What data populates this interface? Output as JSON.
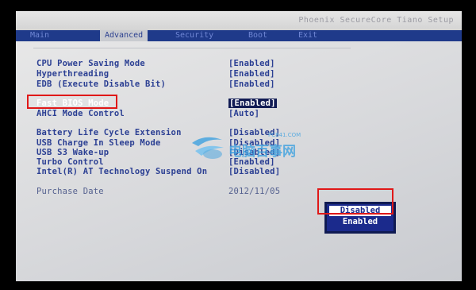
{
  "vendor_text": "Phoenix SecureCore Tiano Setup",
  "tabs": [
    {
      "label": "Main"
    },
    {
      "label": "Advanced"
    },
    {
      "label": "Security"
    },
    {
      "label": "Boot"
    },
    {
      "label": "Exit"
    }
  ],
  "active_tab": "Advanced",
  "settings": [
    {
      "label": "CPU Power Saving Mode",
      "value": "[Enabled]"
    },
    {
      "label": "Hyperthreading",
      "value": "[Enabled]"
    },
    {
      "label": "EDB (Execute Disable Bit)",
      "value": "[Enabled]"
    },
    {
      "label": "Fast BIOS Mode",
      "value": "[Enabled]"
    },
    {
      "label": "AHCI Mode Control",
      "value": "[Auto]"
    },
    {
      "label": "Battery Life Cycle Extension",
      "value": "[Disabled]"
    },
    {
      "label": "USB Charge In Sleep Mode",
      "value": "[Disabled]"
    },
    {
      "label": "USB S3 Wake-up",
      "value": "[Disabled]"
    },
    {
      "label": "Turbo Control",
      "value": "[Enabled]"
    },
    {
      "label": "Intel(R) AT Technology Suspend On",
      "value": "[Disabled]"
    }
  ],
  "purchase": {
    "label": "Purchase Date",
    "value": "2012/11/05"
  },
  "popup": {
    "options": [
      "Disabled",
      "Enabled"
    ],
    "selected": "Disabled"
  },
  "watermark": {
    "text": "电脑百事网",
    "domain": "PC841.COM"
  },
  "colors": {
    "tab_bar": "#1f3a8a",
    "text": "#2b3f93",
    "annotation": "#e01818",
    "popup_bg": "#1b2a8c"
  }
}
